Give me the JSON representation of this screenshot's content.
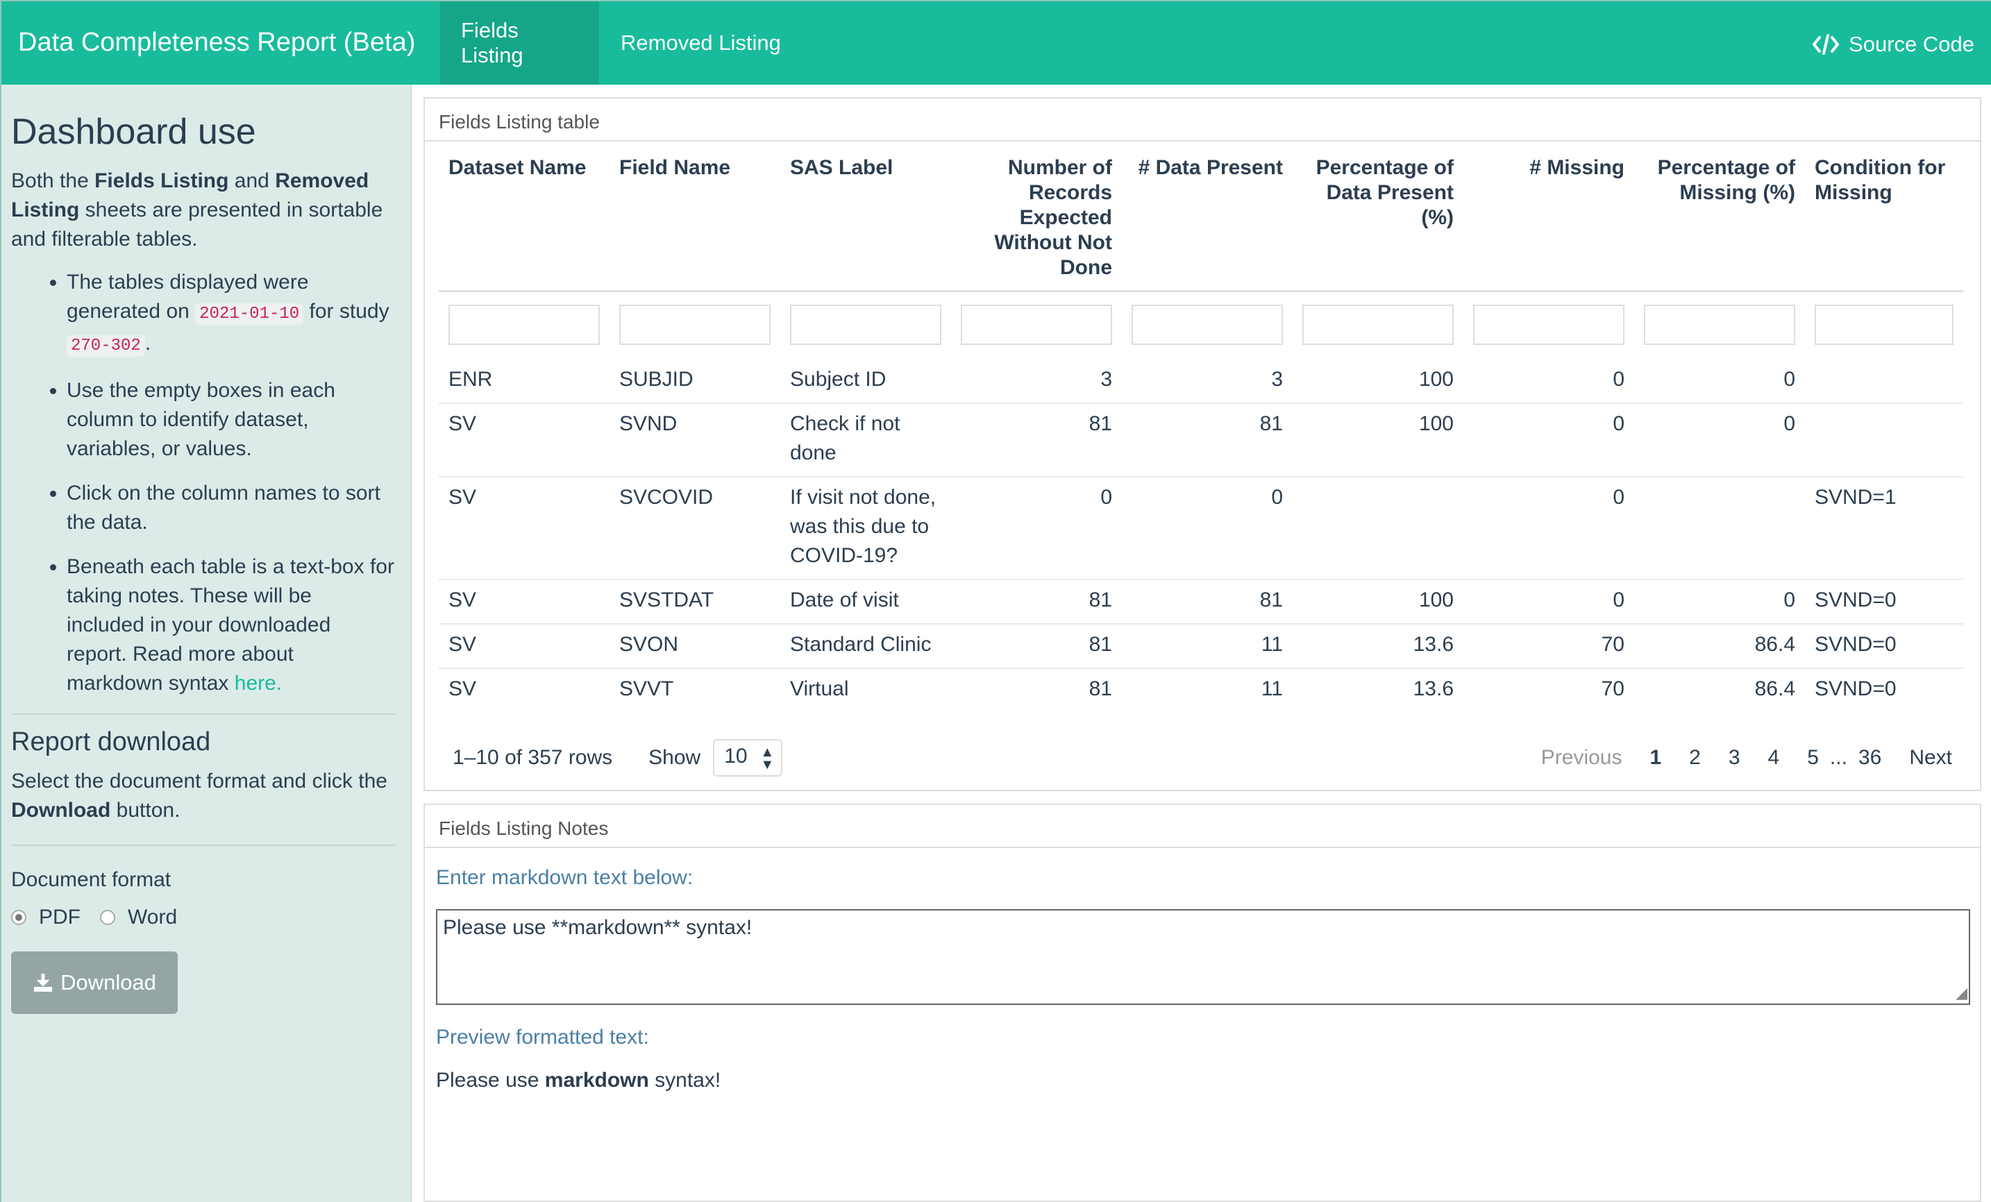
{
  "navbar": {
    "brand": "Data Completeness Report (Beta)",
    "tabs": [
      "Fields Listing",
      "Removed Listing"
    ],
    "source_code": "Source Code",
    "colors": {
      "primary": "#18bc9c",
      "active_tab": "#15a589"
    }
  },
  "sidebar": {
    "title": "Dashboard use",
    "intro": {
      "p1": "Both the ",
      "b1": "Fields Listing",
      "p2": " and ",
      "b2": "Removed Listing",
      "p3": " sheets are presented in sortable and filterable tables."
    },
    "bullet1": {
      "a": "The tables displayed were generated on ",
      "date": "2021-01-10",
      "b": " for study ",
      "study": "270-302",
      "c": "."
    },
    "bullet2": "Use the empty boxes in each column to identify dataset, variables, or values.",
    "bullet3": "Click on the column names to sort the data.",
    "bullet4": {
      "text": "Beneath each table is a text-box for taking notes. These will be included in your downloaded report. Read more about markdown syntax ",
      "link": "here."
    },
    "report_title": "Report download",
    "report_text": {
      "a": "Select the document format and click the ",
      "b": "Download",
      "c": " button."
    },
    "format_label": "Document format",
    "formats": [
      "PDF",
      "Word"
    ],
    "selected_format": "PDF",
    "download_label": "Download"
  },
  "panel1": {
    "title": "Fields Listing table",
    "columns": [
      "Dataset Name",
      "Field Name",
      "SAS Label",
      "Number of Records Expected Without Not Done",
      "# Data Present",
      "Percentage of Data Present (%)",
      "# Missing",
      "Percentage of Missing (%)",
      "Condition for Missing"
    ],
    "rows": [
      [
        "ENR",
        "SUBJID",
        "Subject ID",
        "3",
        "3",
        "100",
        "0",
        "0",
        ""
      ],
      [
        "SV",
        "SVND",
        "Check if not done",
        "81",
        "81",
        "100",
        "0",
        "0",
        ""
      ],
      [
        "SV",
        "SVCOVID",
        "If visit not done, was this due to COVID-19?",
        "0",
        "0",
        "",
        "0",
        "",
        "SVND=1"
      ],
      [
        "SV",
        "SVSTDAT",
        "Date of visit",
        "81",
        "81",
        "100",
        "0",
        "0",
        "SVND=0"
      ],
      [
        "SV",
        "SVON",
        "Standard Clinic",
        "81",
        "11",
        "13.6",
        "70",
        "86.4",
        "SVND=0"
      ],
      [
        "SV",
        "SVVT",
        "Virtual",
        "81",
        "11",
        "13.6",
        "70",
        "86.4",
        "SVND=0"
      ]
    ],
    "info": "1–10 of 357 rows",
    "show_label": "Show",
    "page_size": "10",
    "pager": {
      "previous": "Previous",
      "pages": [
        "1",
        "2",
        "3",
        "4",
        "5"
      ],
      "ellipsis": "...",
      "last": "36",
      "next": "Next",
      "current": "1"
    }
  },
  "panel2": {
    "title": "Fields Listing Notes",
    "input_label": "Enter markdown text below:",
    "input_value": "Please use **markdown** syntax!",
    "preview_label": "Preview formatted text:",
    "preview": {
      "a": "Please use ",
      "b": "markdown",
      "c": " syntax!"
    }
  }
}
